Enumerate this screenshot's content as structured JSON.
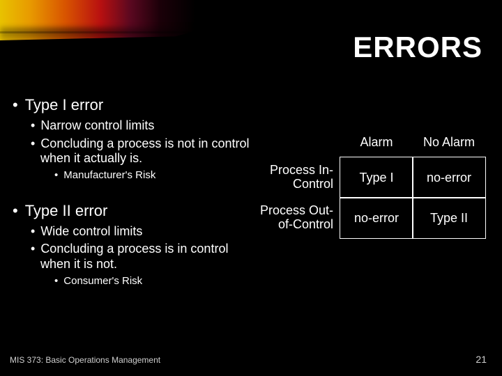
{
  "title": "ERRORS",
  "bullets": {
    "type1": {
      "heading": "Type I error",
      "sub1": "Narrow control limits",
      "sub2": "Concluding a process is not in control when it actually is.",
      "sub3": "Manufacturer's Risk"
    },
    "type2": {
      "heading": "Type II error",
      "sub1": "Wide control limits",
      "sub2": "Concluding a process is in control when it is not.",
      "sub3": "Consumer's Risk"
    }
  },
  "matrix": {
    "col1": "Alarm",
    "col2": "No Alarm",
    "row1": "Process In-Control",
    "row2": "Process Out-of-Control",
    "c11": "Type I",
    "c12": "no-error",
    "c21": "no-error",
    "c22": "Type II"
  },
  "footer": {
    "course": "MIS 373: Basic Operations Management",
    "page": "21"
  }
}
